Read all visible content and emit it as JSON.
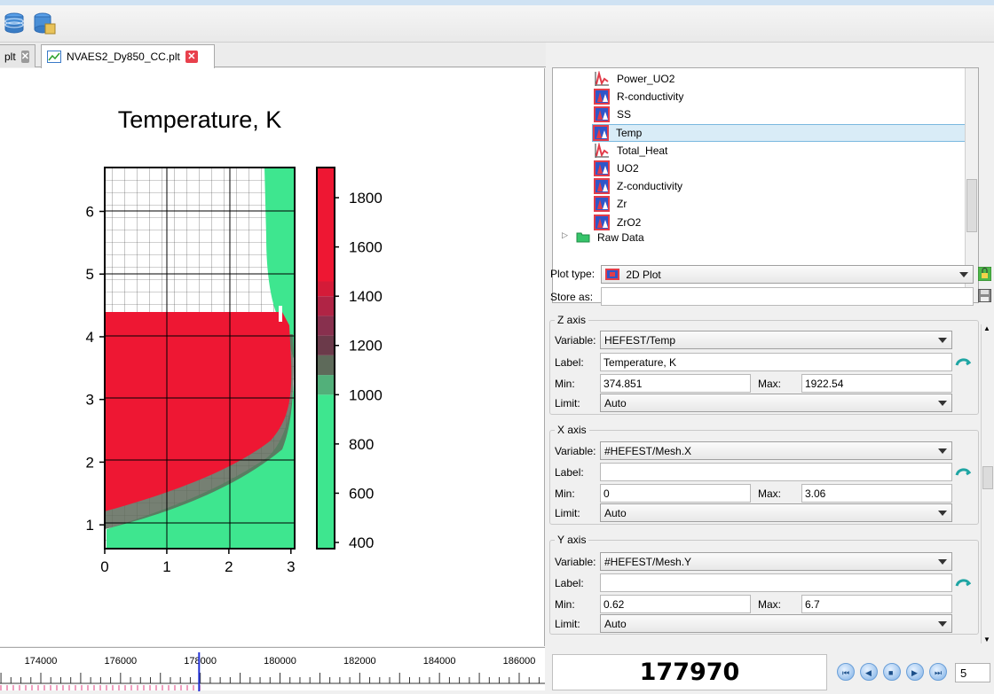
{
  "toolbar": {
    "icons": [
      "database-icon",
      "database-export-icon"
    ]
  },
  "tabs": [
    {
      "label": "plt",
      "active": false
    },
    {
      "label": "NVAES2_Dy850_CC.plt",
      "active": true
    }
  ],
  "chart_data": {
    "type": "heatmap",
    "title": "Temperature, K",
    "xlabel": "",
    "ylabel": "",
    "x_ticks": [
      "0",
      "1",
      "2",
      "3"
    ],
    "y_ticks": [
      "1",
      "2",
      "3",
      "4",
      "5",
      "6"
    ],
    "xlim": [
      0,
      3.06
    ],
    "ylim": [
      0.62,
      6.7
    ],
    "grid": true,
    "colorbar": {
      "min": 374.851,
      "max": 1922.54,
      "ticks": [
        "400",
        "600",
        "800",
        "1000",
        "1200",
        "1400",
        "1600",
        "1800"
      ],
      "colors": [
        "#3ee68f",
        "#52b07a",
        "#5e6a5a",
        "#6b3a4a",
        "#88304e",
        "#b02445",
        "#d41b38",
        "#ee1733"
      ]
    }
  },
  "timeline": {
    "labels": [
      "174000",
      "176000",
      "178000",
      "180000",
      "182000",
      "184000",
      "186000"
    ],
    "current": "177970"
  },
  "tree": {
    "items": [
      {
        "label": "Power_UO2",
        "icon": "line-chart-icon"
      },
      {
        "label": "R-conductivity",
        "icon": "2d-plot-icon"
      },
      {
        "label": "SS",
        "icon": "2d-plot-icon"
      },
      {
        "label": "Temp",
        "icon": "2d-plot-icon",
        "selected": true
      },
      {
        "label": "Total_Heat",
        "icon": "line-chart-icon"
      },
      {
        "label": "UO2",
        "icon": "2d-plot-icon"
      },
      {
        "label": "Z-conductivity",
        "icon": "2d-plot-icon"
      },
      {
        "label": "Zr",
        "icon": "2d-plot-icon"
      },
      {
        "label": "ZrO2",
        "icon": "2d-plot-icon"
      }
    ],
    "raw_data": "Raw Data"
  },
  "plot": {
    "type_label": "Plot type:",
    "type_value": "2D Plot",
    "store_label": "Store as:",
    "store_value": ""
  },
  "labels": {
    "variable": "Variable:",
    "label": "Label:",
    "min": "Min:",
    "max": "Max:",
    "limit": "Limit:"
  },
  "z_axis": {
    "title": "Z axis",
    "variable": "HEFEST/Temp",
    "label": "Temperature, K",
    "min": "374.851",
    "max": "1922.54",
    "limit": "Auto"
  },
  "x_axis": {
    "title": "X axis",
    "variable": "#HEFEST/Mesh.X",
    "label": "",
    "min": "0",
    "max": "3.06",
    "limit": "Auto"
  },
  "y_axis": {
    "title": "Y axis",
    "variable": "#HEFEST/Mesh.Y",
    "label": "",
    "min": "0.62",
    "max": "6.7",
    "limit": "Auto"
  },
  "step": "5"
}
